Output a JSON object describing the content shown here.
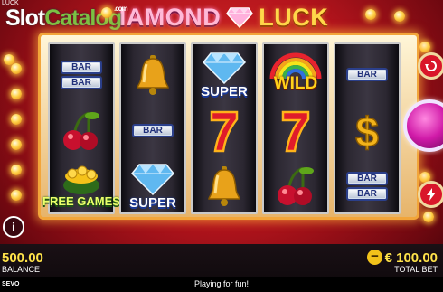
{
  "window": {
    "corner_label": "LUCK"
  },
  "watermark": {
    "part_a": "Slot",
    "part_b": "Catalog",
    "suffix": ".com"
  },
  "game": {
    "title_left": "IAMOND",
    "title_right": "LUCK"
  },
  "reels": [
    {
      "symbols": [
        "bar-double",
        "cherries-icon",
        "free-games"
      ]
    },
    {
      "symbols": [
        "bell-icon",
        "bar-single",
        "diamond-super"
      ]
    },
    {
      "symbols": [
        "diamond-super",
        "seven-icon",
        "bell-icon"
      ]
    },
    {
      "symbols": [
        "rainbow-wild",
        "seven-icon",
        "cherries-icon"
      ]
    },
    {
      "symbols": [
        "bar-single",
        "dollar-icon",
        "bar-double"
      ]
    }
  ],
  "symbol_text": {
    "bar": "BAR",
    "super": "SUPER",
    "wild": "WILD",
    "free_games": "FREE GAMES"
  },
  "controls": {
    "info": "i",
    "minus": "−"
  },
  "balance": {
    "value": "500.00",
    "label": "BALANCE"
  },
  "bet": {
    "value": "€ 100.00",
    "label": "TOTAL BET"
  },
  "footer": {
    "message": "Playing for fun!",
    "brand": "SEVO"
  },
  "colors": {
    "accent_gold": "#ffe34a",
    "spin_magenta": "#d01aa8",
    "background_red": "#b3141c"
  }
}
